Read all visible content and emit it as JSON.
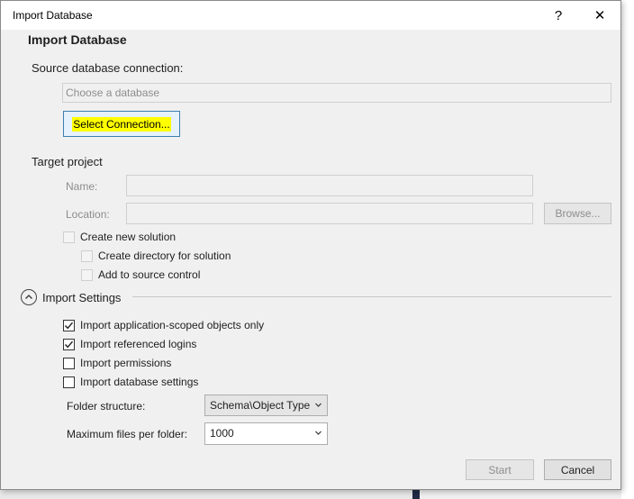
{
  "window": {
    "title": "Import Database",
    "help_glyph": "?",
    "close_glyph": "✕"
  },
  "dialog": {
    "heading": "Import Database"
  },
  "source": {
    "label": "Source database connection:",
    "placeholder": "Choose a database",
    "select_button": "Select Connection..."
  },
  "target": {
    "label": "Target project",
    "name_label": "Name:",
    "name_value": "",
    "location_label": "Location:",
    "location_value": "",
    "browse_button": "Browse...",
    "create_new_solution": "Create new solution",
    "create_directory": "Create directory for solution",
    "add_source_control": "Add to source control"
  },
  "import_settings": {
    "label": "Import Settings",
    "options": [
      {
        "label": "Import application-scoped objects only",
        "checked": true
      },
      {
        "label": "Import referenced logins",
        "checked": true
      },
      {
        "label": "Import permissions",
        "checked": false
      },
      {
        "label": "Import database settings",
        "checked": false
      }
    ],
    "folder_structure_label": "Folder structure:",
    "folder_structure_value": "Schema\\Object Type",
    "max_files_label": "Maximum files per folder:",
    "max_files_value": "1000"
  },
  "footer": {
    "start_button": "Start",
    "cancel_button": "Cancel"
  },
  "colors": {
    "highlight": "#ffff00",
    "focus_border": "#3c7fb1",
    "dialog_bg": "#f0f0f0"
  }
}
